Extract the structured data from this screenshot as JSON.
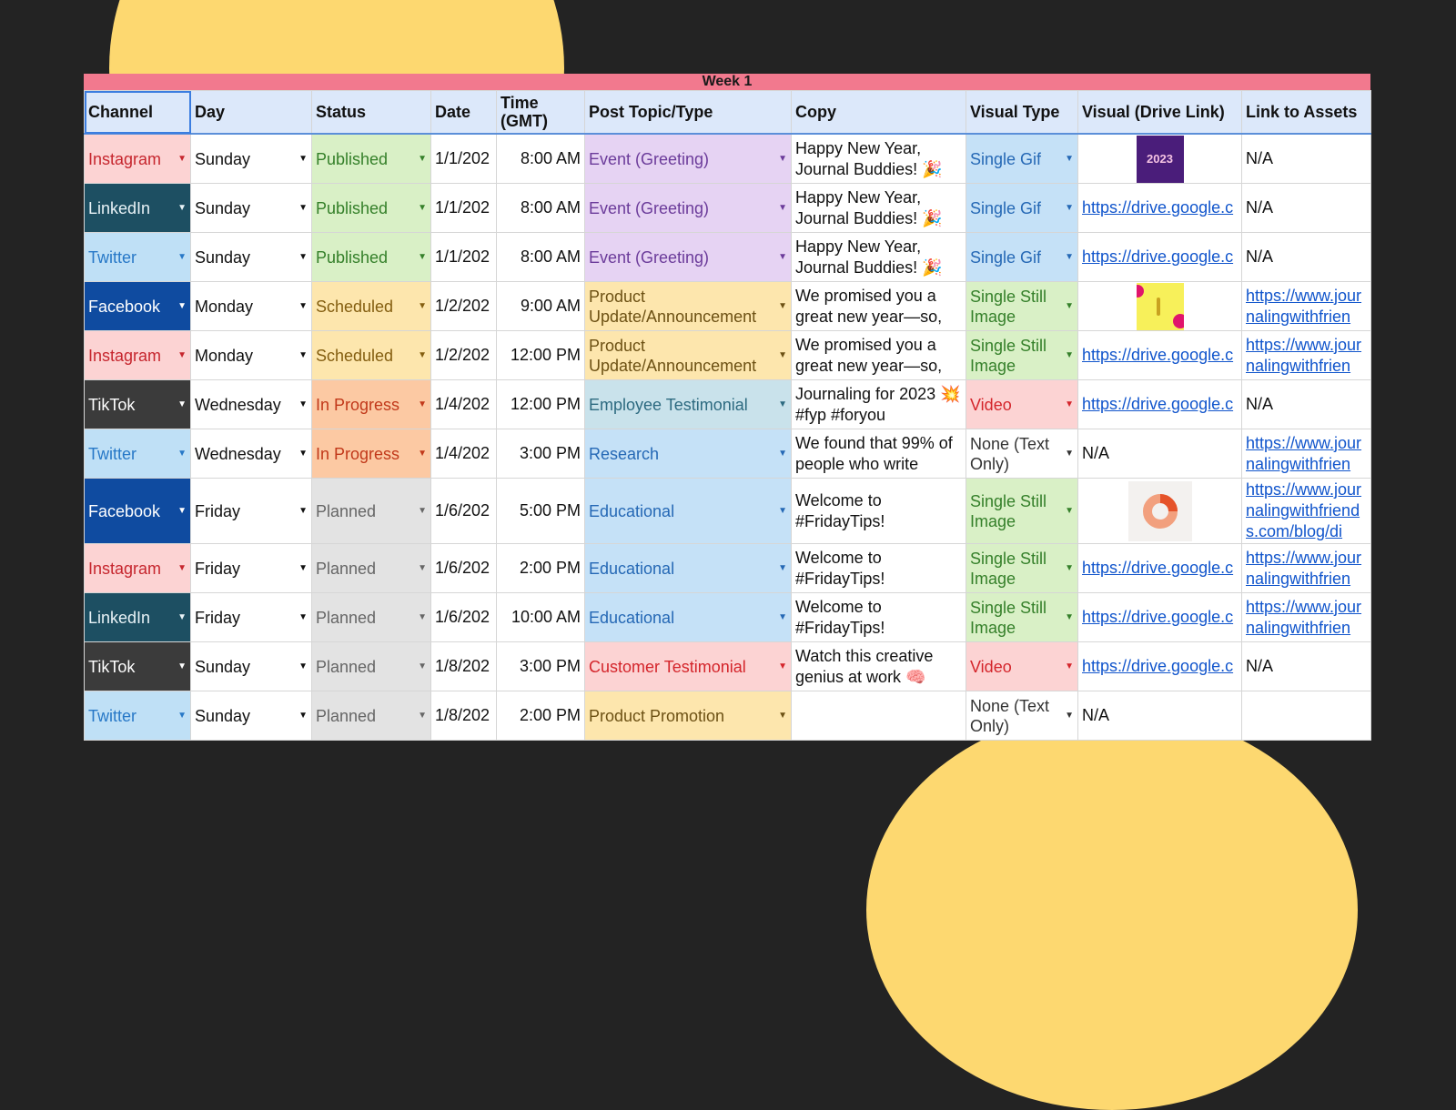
{
  "week_title": "Week 1",
  "headers": [
    "Channel",
    "Day",
    "Status",
    "Date",
    "Time (GMT)",
    "Post Topic/Type",
    "Copy",
    "Visual Type",
    "Visual (Drive Link)",
    "Link to Assets"
  ],
  "rows": [
    {
      "channel": "Instagram",
      "channel_class": "ch-instagram",
      "day": "Sunday",
      "status": "Published",
      "status_class": "st-published",
      "date": "1/1/202",
      "time": "8:00 AM",
      "topic": "Event (Greeting)",
      "topic_class": "tp-event",
      "copy": "Happy New Year, Journal Buddies! 🎉",
      "visual_type": "Single Gif",
      "visual_class": "vt-gif",
      "visual_thumb": "thumb-2023",
      "thumb_text": "2023",
      "visual_link": "",
      "assets": "N/A",
      "assets_is_link": false
    },
    {
      "channel": "LinkedIn",
      "channel_class": "ch-linkedin",
      "day": "Sunday",
      "status": "Published",
      "status_class": "st-published",
      "date": "1/1/202",
      "time": "8:00 AM",
      "topic": "Event (Greeting)",
      "topic_class": "tp-event",
      "copy": "Happy New Year, Journal Buddies! 🎉",
      "visual_type": "Single Gif",
      "visual_class": "vt-gif",
      "visual_thumb": "",
      "visual_link": "https://drive.google.c",
      "assets": "N/A",
      "assets_is_link": false
    },
    {
      "channel": "Twitter",
      "channel_class": "ch-twitter",
      "day": "Sunday",
      "status": "Published",
      "status_class": "st-published",
      "date": "1/1/202",
      "time": "8:00 AM",
      "topic": "Event (Greeting)",
      "topic_class": "tp-event",
      "copy": "Happy New Year, Journal Buddies! 🎉",
      "visual_type": "Single Gif",
      "visual_class": "vt-gif",
      "visual_thumb": "",
      "visual_link": "https://drive.google.c",
      "assets": "N/A",
      "assets_is_link": false
    },
    {
      "channel": "Facebook",
      "channel_class": "ch-facebook",
      "day": "Monday",
      "status": "Scheduled",
      "status_class": "st-scheduled",
      "date": "1/2/202",
      "time": "9:00 AM",
      "topic": "Product Update/Announcement",
      "topic_class": "tp-product",
      "copy": "We promised you a great new year—so,",
      "visual_type": "Single Still Image",
      "visual_class": "vt-still",
      "visual_thumb": "thumb-yellow",
      "visual_link": "",
      "assets": "https://www.journalingwithfrien",
      "assets_is_link": true
    },
    {
      "channel": "Instagram",
      "channel_class": "ch-instagram",
      "day": "Monday",
      "status": "Scheduled",
      "status_class": "st-scheduled",
      "date": "1/2/202",
      "time": "12:00 PM",
      "topic": "Product Update/Announcement",
      "topic_class": "tp-product",
      "copy": "We promised you a great new year—so,",
      "visual_type": "Single Still Image",
      "visual_class": "vt-still",
      "visual_thumb": "",
      "visual_link": "https://drive.google.c",
      "assets": "https://www.journalingwithfrien",
      "assets_is_link": true
    },
    {
      "channel": "TikTok",
      "channel_class": "ch-tiktok",
      "day": "Wednesday",
      "status": "In Progress",
      "status_class": "st-inprogress",
      "date": "1/4/202",
      "time": "12:00 PM",
      "topic": "Employee Testimonial",
      "topic_class": "tp-employee",
      "copy": "Journaling for 2023 💥 #fyp #foryou",
      "visual_type": "Video",
      "visual_class": "vt-video",
      "visual_thumb": "",
      "visual_link": "https://drive.google.c",
      "assets": "N/A",
      "assets_is_link": false
    },
    {
      "channel": "Twitter",
      "channel_class": "ch-twitter",
      "day": "Wednesday",
      "status": "In Progress",
      "status_class": "st-inprogress",
      "date": "1/4/202",
      "time": "3:00 PM",
      "topic": "Research",
      "topic_class": "tp-research",
      "copy": "We found that 99% of people who write",
      "visual_type": "None (Text Only)",
      "visual_class": "vt-none",
      "visual_thumb": "",
      "visual_link": "N/A",
      "assets": "https://www.journalingwithfrien",
      "assets_is_link": true
    },
    {
      "channel": "Facebook",
      "channel_class": "ch-facebook",
      "day": "Friday",
      "status": "Planned",
      "status_class": "st-planned",
      "date": "1/6/202",
      "time": "5:00 PM",
      "topic": "Educational",
      "topic_class": "tp-edu",
      "copy": "Welcome to #FridayTips!",
      "visual_type": "Single Still Image",
      "visual_class": "vt-still",
      "visual_thumb": "thumb-donut",
      "visual_link": "",
      "assets": "https://www.journalingwithfriends.com/blog/di",
      "assets_is_link": true,
      "tall": true
    },
    {
      "channel": "Instagram",
      "channel_class": "ch-instagram",
      "day": "Friday",
      "status": "Planned",
      "status_class": "st-planned",
      "date": "1/6/202",
      "time": "2:00 PM",
      "topic": "Educational",
      "topic_class": "tp-edu",
      "copy": "Welcome to #FridayTips!",
      "visual_type": "Single Still Image",
      "visual_class": "vt-still",
      "visual_thumb": "",
      "visual_link": "https://drive.google.c",
      "assets": "https://www.journalingwithfrien",
      "assets_is_link": true
    },
    {
      "channel": "LinkedIn",
      "channel_class": "ch-linkedin",
      "day": "Friday",
      "status": "Planned",
      "status_class": "st-planned",
      "date": "1/6/202",
      "time": "10:00 AM",
      "topic": "Educational",
      "topic_class": "tp-edu",
      "copy": "Welcome to #FridayTips!",
      "visual_type": "Single Still Image",
      "visual_class": "vt-still",
      "visual_thumb": "",
      "visual_link": "https://drive.google.c",
      "assets": "https://www.journalingwithfrien",
      "assets_is_link": true
    },
    {
      "channel": "TikTok",
      "channel_class": "ch-tiktok",
      "day": "Sunday",
      "status": "Planned",
      "status_class": "st-planned",
      "date": "1/8/202",
      "time": "3:00 PM",
      "topic": "Customer Testimonial",
      "topic_class": "tp-customer",
      "copy": "Watch this creative genius at work 🧠",
      "visual_type": "Video",
      "visual_class": "vt-video",
      "visual_thumb": "",
      "visual_link": "https://drive.google.c",
      "assets": "N/A",
      "assets_is_link": false
    },
    {
      "channel": "Twitter",
      "channel_class": "ch-twitter",
      "day": "Sunday",
      "status": "Planned",
      "status_class": "st-planned",
      "date": "1/8/202",
      "time": "2:00 PM",
      "topic": "Product Promotion",
      "topic_class": "tp-product",
      "copy": "",
      "visual_type": "None (Text Only)",
      "visual_class": "vt-none",
      "visual_thumb": "",
      "visual_link": "N/A",
      "assets": "",
      "assets_is_link": false
    }
  ]
}
